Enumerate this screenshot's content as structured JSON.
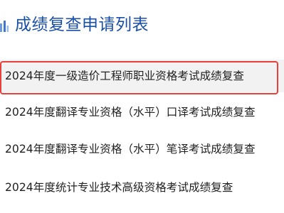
{
  "header": {
    "title": "成绩复查申请列表",
    "icon": "bar-chart-icon",
    "accent_color": "#1a4fa8"
  },
  "list": {
    "items": [
      {
        "label": "2024年度一级造价工程师职业资格考试成绩复查",
        "selected": true
      },
      {
        "label": "2024年度翻译专业资格（水平）口译考试成绩复查",
        "selected": false
      },
      {
        "label": "2024年度翻译专业资格（水平）笔译考试成绩复查",
        "selected": false
      },
      {
        "label": "2024年度统计专业技术高级资格考试成绩复查",
        "selected": false
      }
    ],
    "highlight_color": "#e8413c"
  }
}
